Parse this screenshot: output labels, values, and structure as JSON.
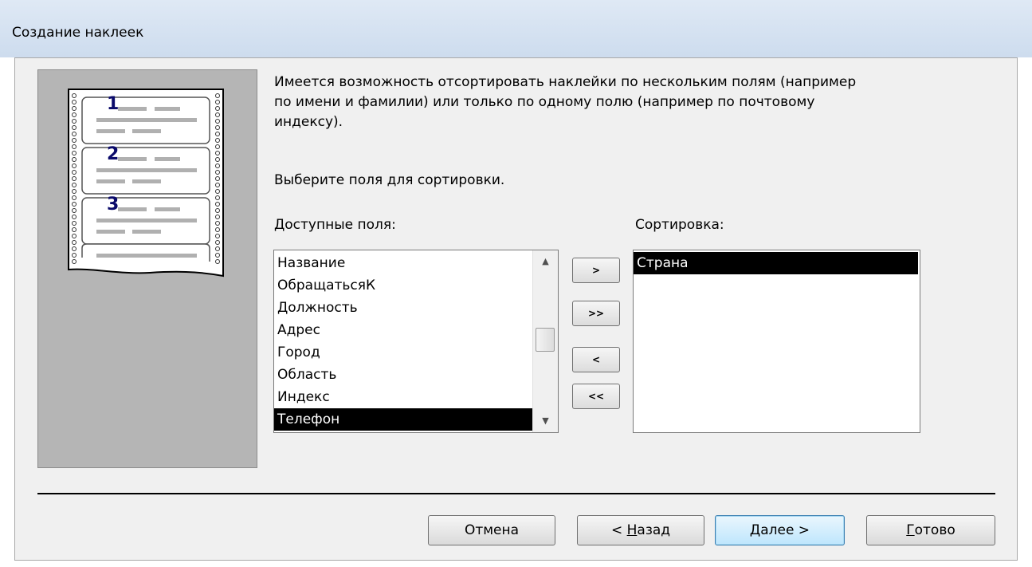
{
  "window": {
    "title": "Создание наклеек"
  },
  "illustration": {
    "numbers": [
      "1",
      "2",
      "3"
    ]
  },
  "description": "Имеется возможность отсортировать наклейки по нескольким полям (например\nпо имени и фамилии) или только по одному полю (например по почтовому\nиндексу).",
  "prompt": "Выберите поля для сортировки.",
  "available": {
    "label": "Доступные поля:",
    "items": [
      "Название",
      "ОбращатьсяК",
      "Должность",
      "Адрес",
      "Город",
      "Область",
      "Индекс",
      "Телефон"
    ],
    "selected_index": 7
  },
  "sort": {
    "label": "Сортировка:",
    "items": [
      "Страна"
    ],
    "selected_index": 0
  },
  "move_buttons": {
    "add": ">",
    "add_all": ">>",
    "remove": "<",
    "remove_all": "<<"
  },
  "buttons": {
    "cancel": "Отмена",
    "back_prefix": "< ",
    "back_accel": "Н",
    "back_rest": "азад",
    "next_accel": "Д",
    "next_rest": "алее >",
    "finish_accel": "Г",
    "finish_rest": "отово"
  }
}
